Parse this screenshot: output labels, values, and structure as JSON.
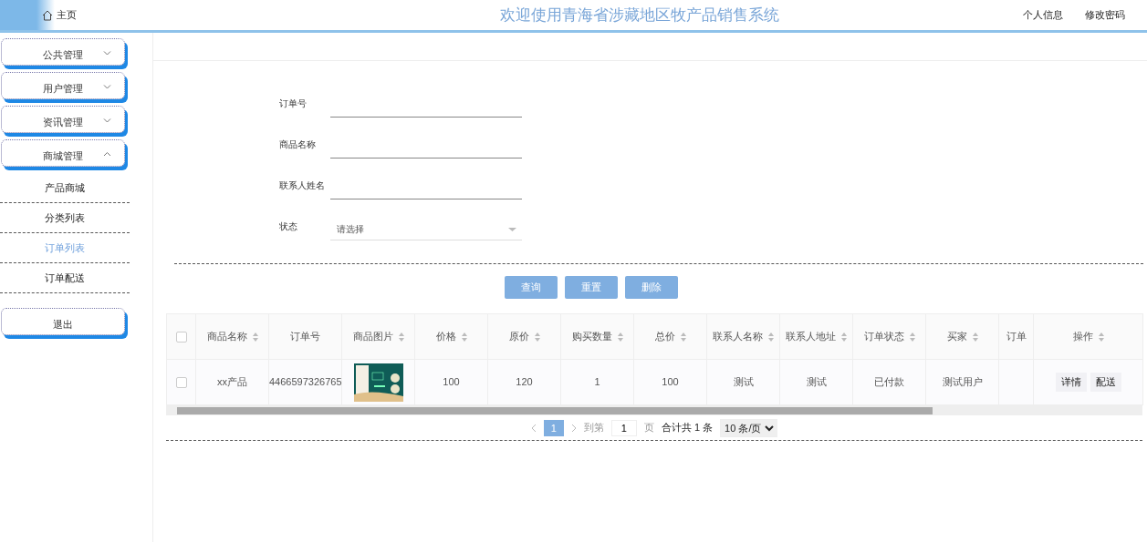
{
  "header": {
    "home": "主页",
    "title": "欢迎使用青海省涉藏地区牧产品销售系统",
    "links": [
      "个人信息",
      "修改密码"
    ]
  },
  "sidebar": {
    "menus": [
      {
        "label": "公共管理",
        "expanded": false
      },
      {
        "label": "用户管理",
        "expanded": false
      },
      {
        "label": "资讯管理",
        "expanded": false
      },
      {
        "label": "商城管理",
        "expanded": true,
        "children": [
          {
            "label": "产品商城",
            "selected": false
          },
          {
            "label": "分类列表",
            "selected": false
          },
          {
            "label": "订单列表",
            "selected": true
          },
          {
            "label": "订单配送",
            "selected": false
          }
        ]
      }
    ],
    "logout": "退出"
  },
  "search_form": {
    "fields": [
      {
        "kind": "text",
        "label": "订单号"
      },
      {
        "kind": "text",
        "label": "商品名称"
      },
      {
        "kind": "text",
        "label": "联系人姓名"
      },
      {
        "kind": "select",
        "label": "状态",
        "placeholder": "请选择"
      }
    ],
    "buttons": [
      "查询",
      "重置",
      "删除"
    ]
  },
  "table": {
    "columns": [
      {
        "label": "商品名称",
        "sortable": true
      },
      {
        "label": "订单号",
        "sortable": false
      },
      {
        "label": "商品图片",
        "sortable": true
      },
      {
        "label": "价格",
        "sortable": true
      },
      {
        "label": "原价",
        "sortable": true
      },
      {
        "label": "购买数量",
        "sortable": true
      },
      {
        "label": "总价",
        "sortable": true
      },
      {
        "label": "联系人名称",
        "sortable": true
      },
      {
        "label": "联系人地址",
        "sortable": true
      },
      {
        "label": "订单状态",
        "sortable": true
      },
      {
        "label": "买家",
        "sortable": true
      },
      {
        "label": "订单",
        "sortable": false
      }
    ],
    "action_column": {
      "label": "操作",
      "sortable": true
    },
    "select_all_checked": false,
    "rows": [
      {
        "checked": false,
        "cells": [
          {
            "kind": "text",
            "text": "xx产品"
          },
          {
            "kind": "text",
            "text": "4466597326765"
          },
          {
            "kind": "picture"
          },
          {
            "kind": "text",
            "text": "100"
          },
          {
            "kind": "text",
            "text": "120"
          },
          {
            "kind": "text",
            "text": "1"
          },
          {
            "kind": "text",
            "text": "100"
          },
          {
            "kind": "text",
            "text": "测试"
          },
          {
            "kind": "text",
            "text": "测试"
          },
          {
            "kind": "text",
            "text": "已付款"
          },
          {
            "kind": "text",
            "text": "测试用户"
          },
          {
            "kind": "blank"
          }
        ],
        "actions": [
          "详情",
          "配送"
        ]
      }
    ]
  },
  "pagination": {
    "pages": [
      {
        "label": "1",
        "selected": true
      }
    ],
    "goto_label": "到第",
    "goto_value": "1",
    "page_suffix": "页",
    "total": "合计共 1 条",
    "page_size": "10 条/页"
  }
}
